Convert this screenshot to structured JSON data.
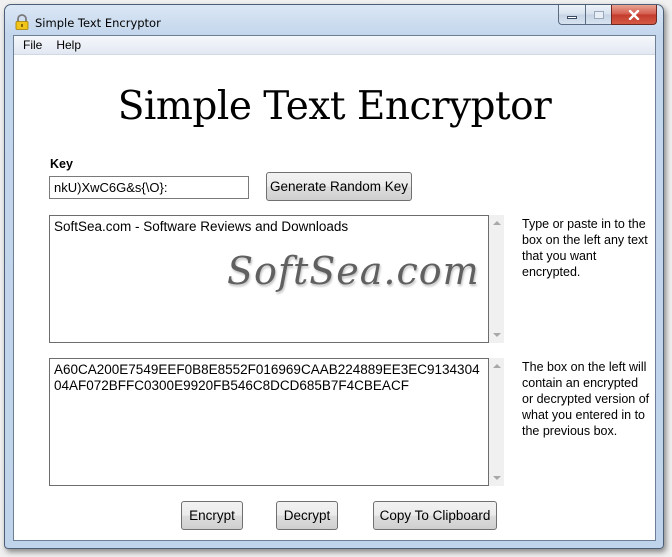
{
  "window": {
    "title": "Simple Text Encryptor",
    "controls": {
      "minimize": "minimize",
      "maximize": "maximize",
      "close": "close"
    }
  },
  "menu": {
    "items": [
      {
        "label": "File"
      },
      {
        "label": "Help"
      }
    ]
  },
  "app": {
    "heading": "Simple Text Encryptor",
    "key_label": "Key",
    "key_value": "nkU)XwC6G&s{\\O}:",
    "generate_button": "Generate Random Key",
    "input_text": "SoftSea.com - Software Reviews and Downloads",
    "input_hint": "Type or paste in to the box on the left any text that you want encrypted.",
    "output_text": "A60CA200E7549EEF0B8E8552F016969CAAB224889EE3EC913430404AF072BFFC0300E9920FB546C8DCD685B7F4CBEACF",
    "output_hint": "The box on the left will contain an encrypted or decrypted version of what you entered in to the previous box.",
    "encrypt_button": "Encrypt",
    "decrypt_button": "Decrypt",
    "copy_button": "Copy To Clipboard"
  },
  "watermark": "SoftSea.com",
  "icons": {
    "title": "lock-icon"
  },
  "colors": {
    "titlebar": "#c3d6ec",
    "close_button": "#c33b2c",
    "lock": "#e8b800"
  }
}
